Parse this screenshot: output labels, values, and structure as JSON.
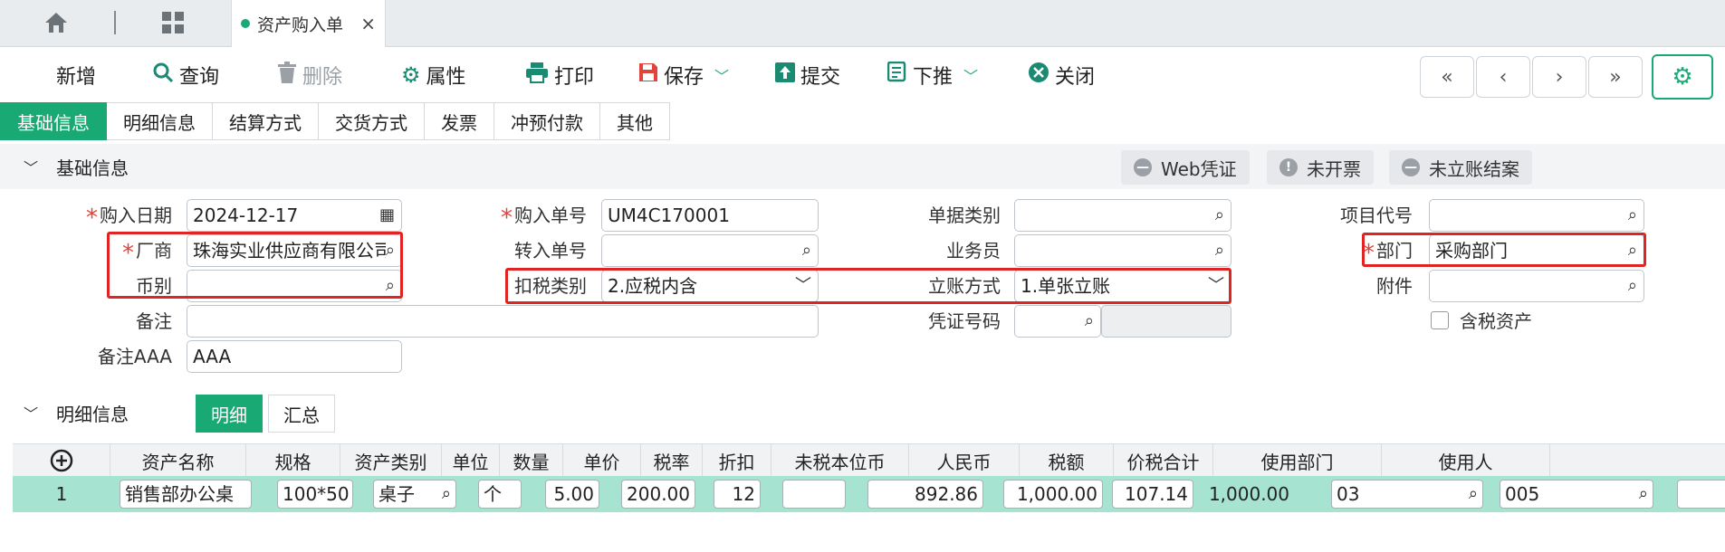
{
  "top_tabs": {
    "home_icon": "home-icon",
    "grid_icon": "grid-icon",
    "doc_tab_label": "资产购入单",
    "close": "×"
  },
  "toolbar": {
    "add": "新增",
    "query": "查询",
    "delete": "删除",
    "properties": "属性",
    "print": "打印",
    "save": "保存",
    "submit": "提交",
    "push_down": "下推",
    "close": "关闭"
  },
  "nav": {
    "first": "«",
    "prev": "‹",
    "next": "›",
    "last": "»"
  },
  "section_tabs": [
    "基础信息",
    "明细信息",
    "结算方式",
    "交货方式",
    "发票",
    "冲预付款",
    "其他"
  ],
  "basic": {
    "header": "基础信息",
    "web_voucher": "Web凭证",
    "uninvoiced": "未开票",
    "unposted": "未立账结案",
    "purchase_date_label": "购入日期",
    "purchase_date": "2024-12-17",
    "purchase_no_label": "购入单号",
    "purchase_no": "UM4C170001",
    "doc_type_label": "单据类别",
    "doc_type": "",
    "project_code_label": "项目代号",
    "project_code": "",
    "vendor_label": "厂商",
    "vendor": "珠海实业供应商有限公司",
    "transfer_no_label": "转入单号",
    "transfer_no": "",
    "salesman_label": "业务员",
    "salesman": "",
    "dept_label": "部门",
    "dept": "采购部门",
    "currency_label": "币别",
    "currency": "",
    "tax_type_label": "扣税类别",
    "tax_type": "2.应税内含",
    "posting_label": "立账方式",
    "posting": "1.单张立账",
    "attachment_label": "附件",
    "attachment": "",
    "remark_label": "备注",
    "remark": "",
    "voucher_no_label": "凭证号码",
    "voucher_no": "",
    "tax_asset_label": "含税资产",
    "remark_aaa_label": "备注AAA",
    "remark_aaa": "AAA"
  },
  "detail": {
    "header": "明细信息",
    "tab_detail": "明细",
    "tab_summary": "汇总",
    "columns": [
      "资产名称",
      "规格",
      "资产类别",
      "单位",
      "数量",
      "单价",
      "税率",
      "折扣",
      "未税本位币",
      "人民币",
      "税额",
      "价税合计",
      "使用部门",
      "使用人"
    ],
    "row": {
      "no": "1",
      "name": "销售部办公桌",
      "spec": "100*50",
      "category": "桌子",
      "unit": "个",
      "qty": "5.00",
      "price": "200.00",
      "rate": "12",
      "discount": "",
      "untaxed": "892.86",
      "rmb": "1,000.00",
      "tax": "107.14",
      "total": "1,000.00",
      "dept": "03",
      "user": "005"
    }
  },
  "colors": {
    "accent": "#19a974",
    "highlight": "#e02424",
    "row_bg": "#a6e3d1"
  }
}
